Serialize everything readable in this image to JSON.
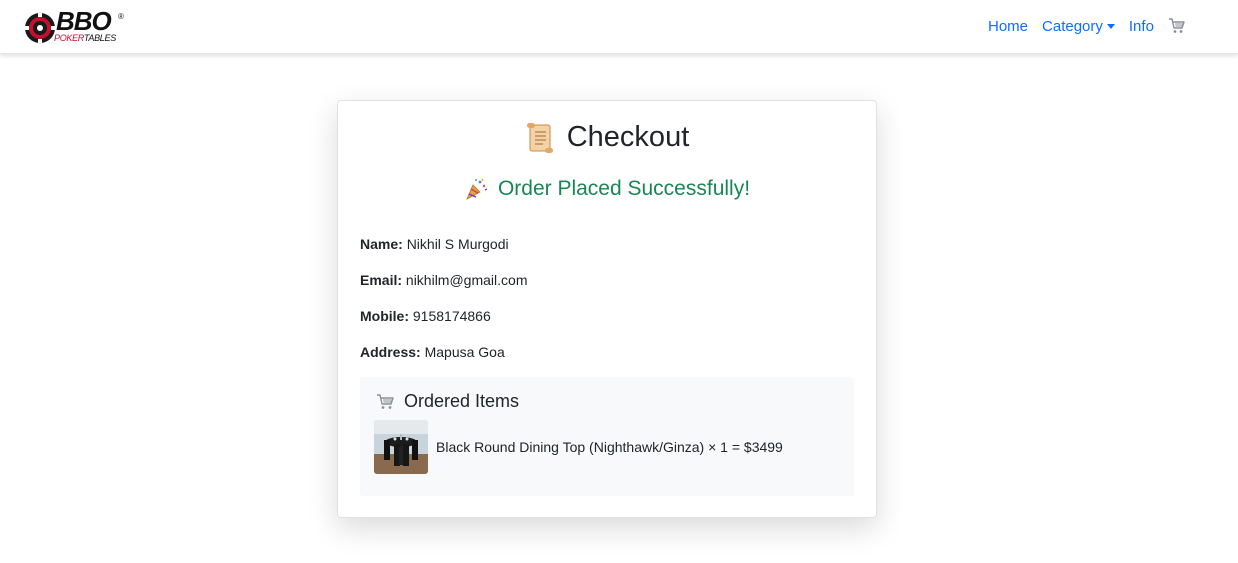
{
  "brand": {
    "logo_main": "BBO",
    "logo_sub_red": "POKER",
    "logo_sub_dark": "TABLES",
    "logo_reg": "®"
  },
  "nav": {
    "home": "Home",
    "category": "Category",
    "info": "Info",
    "cart_icon": "cart-icon"
  },
  "checkout": {
    "title": "Checkout",
    "title_icon": "scroll-icon",
    "success_message": "Order Placed Successfully!",
    "success_icon": "party-popper-icon",
    "name_label": "Name:",
    "name_value": "Nikhil S Murgodi",
    "email_label": "Email:",
    "email_value": "nikhilm@gmail.com",
    "mobile_label": "Mobile:",
    "mobile_value": "9158174866",
    "address_label": "Address:",
    "address_value": "Mapusa Goa"
  },
  "ordered_items": {
    "title": "Ordered Items",
    "title_icon": "cart-icon",
    "items": [
      {
        "text": "Black Round Dining Top (Nighthawk/Ginza) × 1 = $3499"
      }
    ]
  },
  "colors": {
    "link": "#0d6efd",
    "success": "#198754",
    "brand_red": "#c8102e"
  }
}
